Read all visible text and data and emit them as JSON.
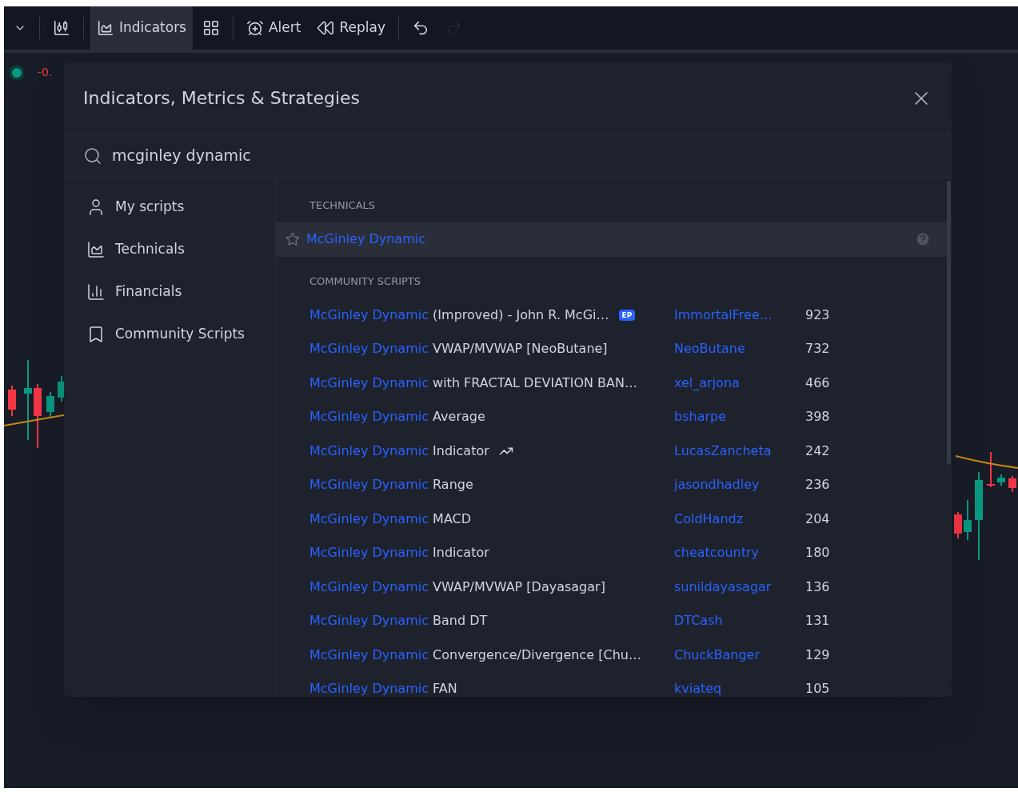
{
  "toolbar": {
    "items": [
      {
        "kind": "caret"
      },
      {
        "kind": "candles"
      },
      {
        "kind": "indicators",
        "label": "Indicators",
        "selected": true
      },
      {
        "kind": "templates"
      },
      {
        "kind": "alert",
        "label": "Alert"
      },
      {
        "kind": "replay",
        "label": "Replay"
      },
      {
        "kind": "undo",
        "disabled": false
      },
      {
        "kind": "redo",
        "disabled": true
      }
    ]
  },
  "legend": {
    "value": "-0."
  },
  "dialog": {
    "title": "Indicators, Metrics & Strategies",
    "search": {
      "value": "mcginley dynamic"
    },
    "sidebar": {
      "items": [
        {
          "kind": "user",
          "label": "My scripts"
        },
        {
          "kind": "technicals",
          "label": "Technicals"
        },
        {
          "kind": "financials",
          "label": "Financials"
        },
        {
          "kind": "bookmark",
          "label": "Community Scripts"
        }
      ]
    },
    "sections": [
      {
        "heading": "TECHNICALS",
        "kind": "technicals",
        "rows": [
          {
            "match": "McGinley Dynamic",
            "rest": "",
            "selected": true
          }
        ]
      },
      {
        "heading": "COMMUNITY SCRIPTS",
        "kind": "community",
        "rows": [
          {
            "match": "McGinley Dynamic",
            "rest": " (Improved) - John R. McGi…",
            "badge": "EP",
            "author": "ImmortalFree…",
            "count": "923",
            "trending": false
          },
          {
            "match": "McGinley Dynamic",
            "rest": " VWAP/MVWAP [NeoButane]",
            "author": "NeoButane",
            "count": "732",
            "trending": false
          },
          {
            "match": "McGinley Dynamic",
            "rest": " with FRACTAL DEVIATION BAN…",
            "author": "xel_arjona",
            "count": "466",
            "trending": false
          },
          {
            "match": "McGinley Dynamic",
            "rest": " Average",
            "author": "bsharpe",
            "count": "398",
            "trending": false
          },
          {
            "match": "McGinley Dynamic",
            "rest": " Indicator",
            "author": "LucasZancheta",
            "count": "242",
            "trending": true
          },
          {
            "match": "McGinley Dynamic",
            "rest": " Range",
            "author": "jasondhadley",
            "count": "236",
            "trending": false
          },
          {
            "match": "McGinley Dynamic",
            "rest": " MACD",
            "author": "ColdHandz",
            "count": "204",
            "trending": false
          },
          {
            "match": "McGinley Dynamic",
            "rest": " Indicator",
            "author": "cheatcountry",
            "count": "180",
            "trending": false
          },
          {
            "match": "McGinley Dynamic",
            "rest": " VWAP/MVWAP [Dayasagar]",
            "author": "sunildayasagar",
            "count": "136",
            "trending": false
          },
          {
            "match": "McGinley Dynamic",
            "rest": " Band DT",
            "author": "DTCash",
            "count": "131",
            "trending": false
          },
          {
            "match": "McGinley Dynamic",
            "rest": " Convergence/Divergence [Chu…",
            "author": "ChuckBanger",
            "count": "129",
            "trending": false
          },
          {
            "match": "McGinley Dynamic",
            "rest": " FAN",
            "author": "kviateq",
            "count": "105",
            "trending": false
          }
        ]
      }
    ]
  }
}
